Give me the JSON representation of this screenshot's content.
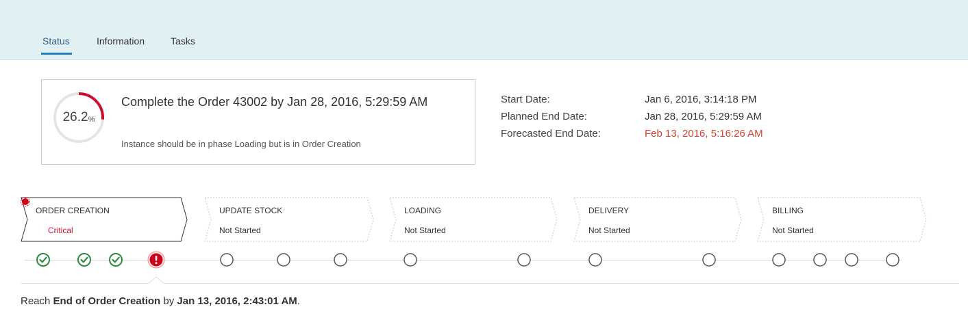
{
  "tabs": [
    {
      "label": "Status",
      "active": true
    },
    {
      "label": "Information",
      "active": false
    },
    {
      "label": "Tasks",
      "active": false
    }
  ],
  "header": {
    "progress_value": "26.2",
    "progress_unit": "%",
    "progress_fraction": 0.262,
    "title": "Complete the Order 43002 by Jan 28, 2016, 5:29:59 AM",
    "subtitle": "Instance should be in phase Loading but is in Order Creation"
  },
  "dates": [
    {
      "label": "Start Date:",
      "value": "Jan 6, 2016, 3:14:18 PM",
      "highlight": false
    },
    {
      "label": "Planned End Date:",
      "value": "Jan 28, 2016, 5:29:59 AM",
      "highlight": false
    },
    {
      "label": "Forecasted End Date:",
      "value": "Feb 13, 2016, 5:16:26 AM",
      "highlight": true
    }
  ],
  "phases": [
    {
      "name": "ORDER CREATION",
      "status": "Critical",
      "critical": true
    },
    {
      "name": "UPDATE STOCK",
      "status": "Not Started",
      "critical": false
    },
    {
      "name": "LOADING",
      "status": "Not Started",
      "critical": false
    },
    {
      "name": "DELIVERY",
      "status": "Not Started",
      "critical": false
    },
    {
      "name": "BILLING",
      "status": "Not Started",
      "critical": false
    }
  ],
  "milestones": {
    "completed": 3,
    "critical": 1,
    "pending": 11
  },
  "footer": {
    "prefix": "Reach ",
    "milestone": "End of Order Creation",
    "middle": " by ",
    "due": "Jan 13, 2016, 2:43:01 AM",
    "suffix": "."
  },
  "colors": {
    "header_bg": "#e1f0f2",
    "tab_active": "#346187",
    "tab_indicator": "#2b7fb8",
    "gauge_progress": "#c8102e",
    "gauge_track": "#e5e5e5",
    "success": "#2b8a3e",
    "critical": "#d0021b",
    "forecast_red": "#d0402f"
  }
}
